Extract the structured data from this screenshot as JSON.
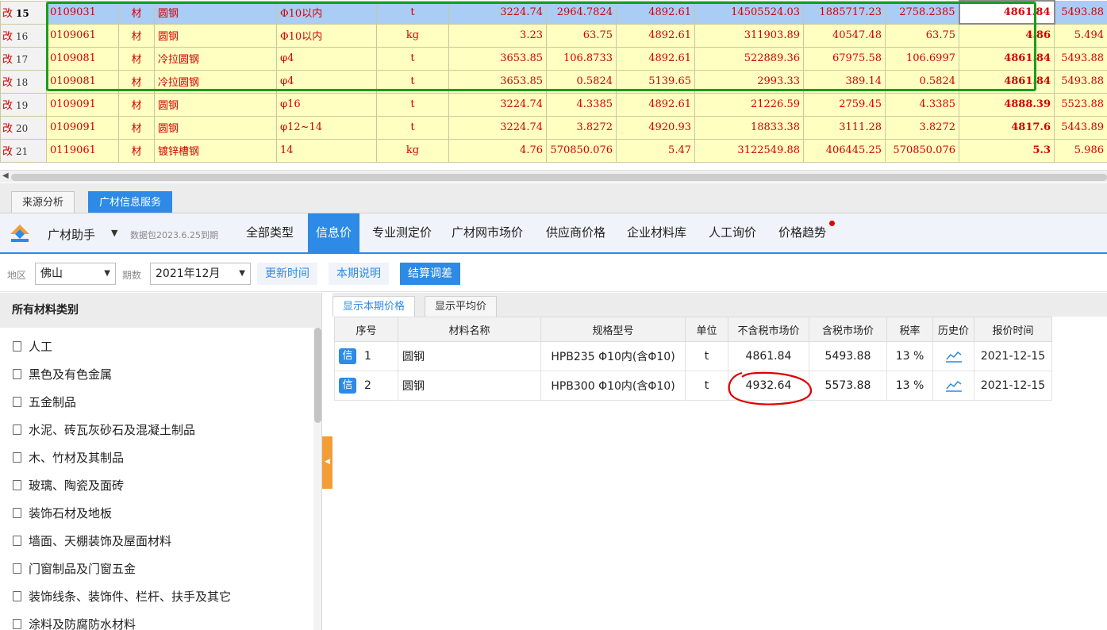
{
  "top_grid": {
    "rows": [
      {
        "mark": "改",
        "num": "15",
        "code": "0109031",
        "kind": "材",
        "name": "圆钢",
        "spec": "Φ10以内",
        "unit": "t",
        "v1": "3224.74",
        "v2": "2964.7824",
        "v3": "4892.61",
        "v4": "14505524.03",
        "v5": "1885717.23",
        "v6": "2758.2385",
        "v7": "4861.84",
        "v8": "5493.88"
      },
      {
        "mark": "改",
        "num": "16",
        "code": "0109061",
        "kind": "材",
        "name": "圆钢",
        "spec": "Φ10以内",
        "unit": "kg",
        "v1": "3.23",
        "v2": "63.75",
        "v3": "4892.61",
        "v4": "311903.89",
        "v5": "40547.48",
        "v6": "63.75",
        "v7": "4.86",
        "v8": "5.494"
      },
      {
        "mark": "改",
        "num": "17",
        "code": "0109081",
        "kind": "材",
        "name": "冷拉圆钢",
        "spec": "φ4",
        "unit": "t",
        "v1": "3653.85",
        "v2": "106.8733",
        "v3": "4892.61",
        "v4": "522889.36",
        "v5": "67975.58",
        "v6": "106.6997",
        "v7": "4861.84",
        "v8": "5493.88"
      },
      {
        "mark": "改",
        "num": "18",
        "code": "0109081",
        "kind": "材",
        "name": "冷拉圆钢",
        "spec": "φ4",
        "unit": "t",
        "v1": "3653.85",
        "v2": "0.5824",
        "v3": "5139.65",
        "v4": "2993.33",
        "v5": "389.14",
        "v6": "0.5824",
        "v7": "4861.84",
        "v8": "5493.88"
      },
      {
        "mark": "改",
        "num": "19",
        "code": "0109091",
        "kind": "材",
        "name": "圆钢",
        "spec": "φ16",
        "unit": "t",
        "v1": "3224.74",
        "v2": "4.3385",
        "v3": "4892.61",
        "v4": "21226.59",
        "v5": "2759.45",
        "v6": "4.3385",
        "v7": "4888.39",
        "v8": "5523.88"
      },
      {
        "mark": "改",
        "num": "20",
        "code": "0109091",
        "kind": "材",
        "name": "圆钢",
        "spec": "φ12~14",
        "unit": "t",
        "v1": "3224.74",
        "v2": "3.8272",
        "v3": "4920.93",
        "v4": "18833.38",
        "v5": "3111.28",
        "v6": "3.8272",
        "v7": "4817.6",
        "v8": "5443.89"
      },
      {
        "mark": "改",
        "num": "21",
        "code": "0119061",
        "kind": "材",
        "name": "镀锌槽钢",
        "spec": "14",
        "unit": "kg",
        "v1": "4.76",
        "v2": "570850.076",
        "v3": "5.47",
        "v4": "3122549.88",
        "v5": "406445.25",
        "v6": "570850.076",
        "v7": "5.3",
        "v8": "5.986"
      }
    ]
  },
  "bottom_tabs": [
    {
      "label": "来源分析"
    },
    {
      "label": "广材信息服务"
    }
  ],
  "assistant": {
    "name": "广材助手",
    "package_note": "数据包2023.6.25到期",
    "tabs": [
      {
        "label": "全部类型"
      },
      {
        "label": "信息价"
      },
      {
        "label": "专业测定价"
      },
      {
        "label": "广材网市场价"
      },
      {
        "label": "供应商价格"
      },
      {
        "label": "企业材料库"
      },
      {
        "label": "人工询价"
      },
      {
        "label": "价格趋势"
      }
    ]
  },
  "filters": {
    "region_label": "地区",
    "region_value": "佛山",
    "period_label": "期数",
    "period_value": "2021年12月",
    "btn_update_time": "更新时间",
    "btn_period_note": "本期说明",
    "btn_settle_diff": "结算调差"
  },
  "categories": {
    "header": "所有材料类别",
    "items": [
      {
        "label": "人工"
      },
      {
        "label": "黑色及有色金属"
      },
      {
        "label": "五金制品"
      },
      {
        "label": "水泥、砖瓦灰砂石及混凝土制品"
      },
      {
        "label": "木、竹材及其制品"
      },
      {
        "label": "玻璃、陶瓷及面砖"
      },
      {
        "label": "装饰石材及地板"
      },
      {
        "label": "墙面、天棚装饰及屋面材料"
      },
      {
        "label": "门窗制品及门窗五金"
      },
      {
        "label": "装饰线条、装饰件、栏杆、扶手及其它"
      },
      {
        "label": "涂料及防腐防水材料"
      }
    ]
  },
  "price_panel": {
    "tabs": [
      {
        "label": "显示本期价格"
      },
      {
        "label": "显示平均价"
      }
    ],
    "headers": {
      "seq": "序号",
      "name": "材料名称",
      "spec": "规格型号",
      "unit": "单位",
      "price_ex": "不含税市场价",
      "price_in": "含税市场价",
      "tax": "税率",
      "history": "历史价",
      "date": "报价时间"
    },
    "rows": [
      {
        "badge": "信",
        "seq": "1",
        "name": "圆钢",
        "spec": "HPB235 Φ10内(含Φ10)",
        "unit": "t",
        "price_ex": "4861.84",
        "price_in": "5493.88",
        "tax": "13 %",
        "date": "2021-12-15"
      },
      {
        "badge": "信",
        "seq": "2",
        "name": "圆钢",
        "spec": "HPB300 Φ10内(含Φ10)",
        "unit": "t",
        "price_ex": "4932.64",
        "price_in": "5573.88",
        "tax": "13 %",
        "date": "2021-12-15"
      }
    ]
  },
  "colors": {
    "accent": "#2d8ae6",
    "grid_text_red": "#d40000",
    "grid_row_yellow": "#ffffc2",
    "grid_row_selected": "#a9cdf5",
    "highlight_green": "#1a9e1a",
    "annotation_red": "#e00000",
    "handle_orange": "#f39d37"
  }
}
